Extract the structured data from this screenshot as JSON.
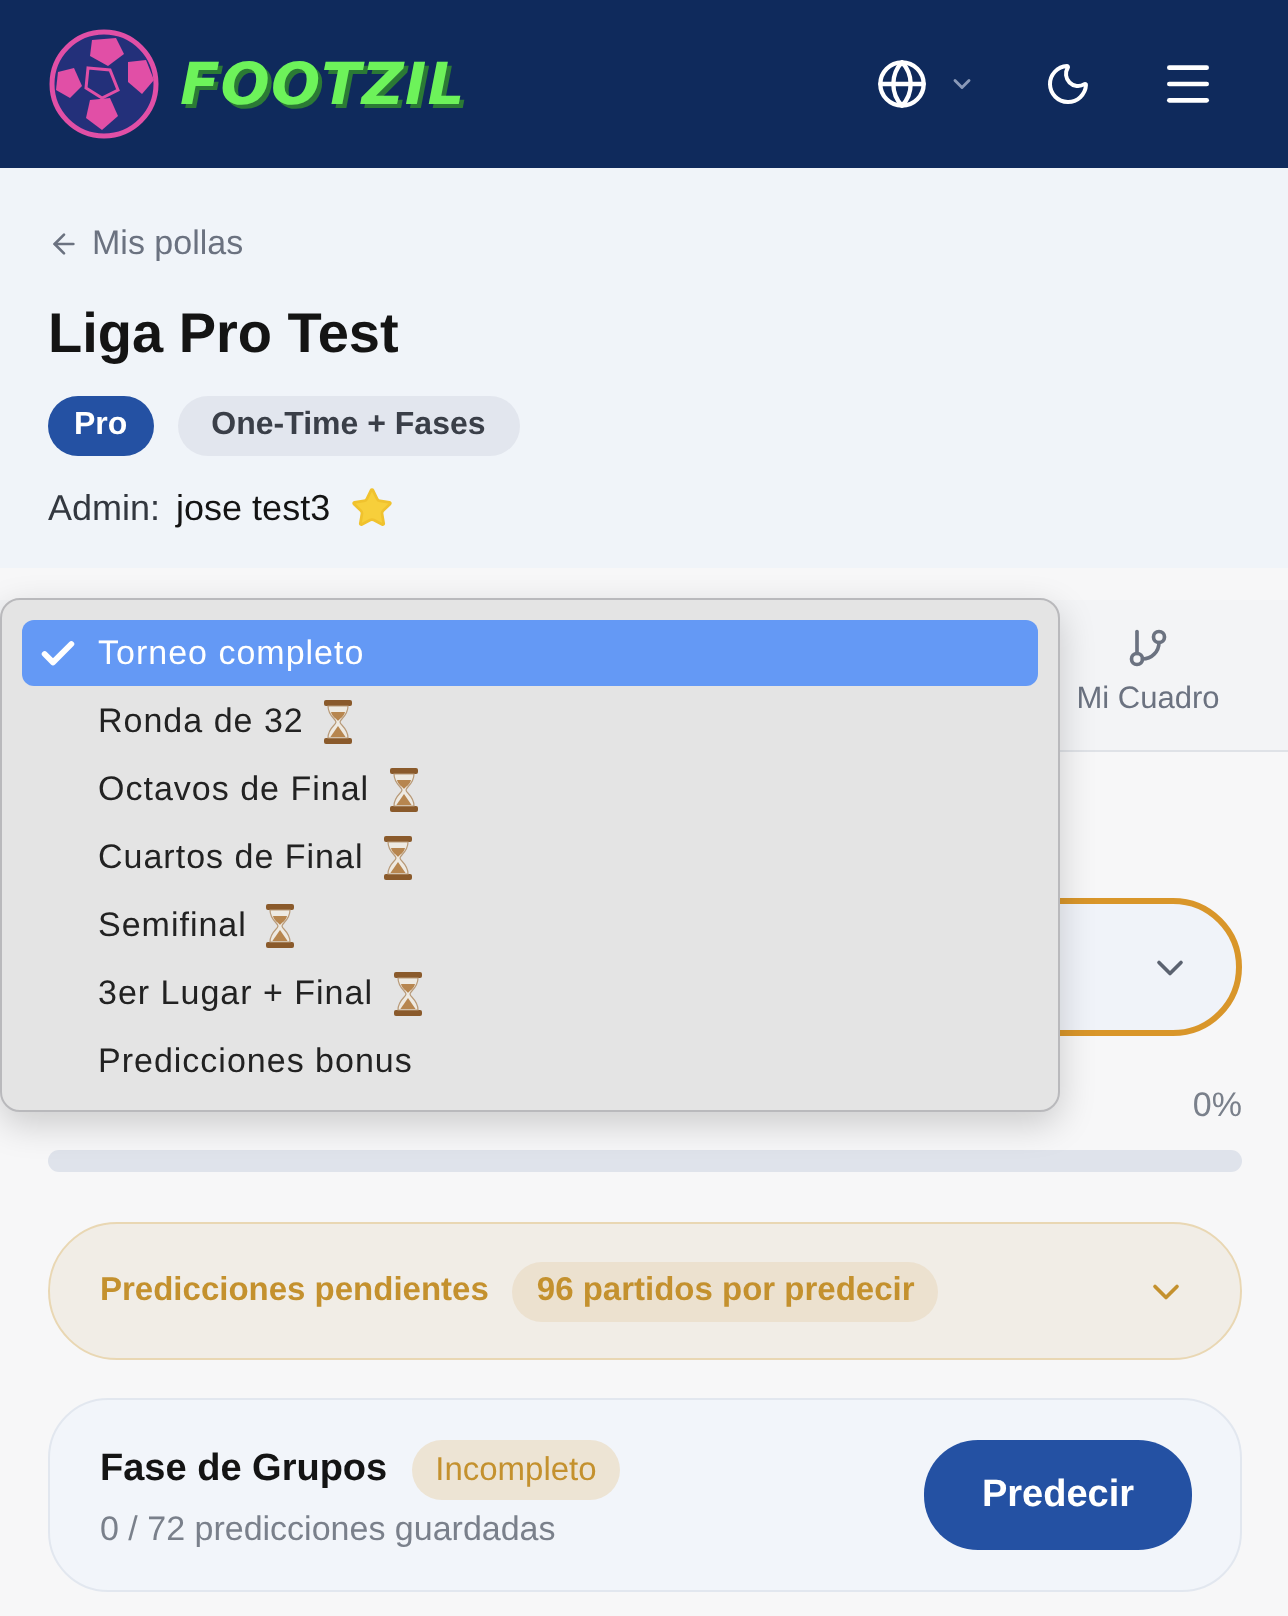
{
  "header": {
    "brand": "FOOTZIL"
  },
  "back_link": {
    "label": "Mis pollas"
  },
  "league": {
    "title": "Liga Pro Test",
    "badges": [
      {
        "label": "Pro",
        "kind": "plan"
      },
      {
        "label": "One-Time + Fases",
        "kind": "mode"
      }
    ],
    "admin_label": "Admin:",
    "admin_name": "jose test3"
  },
  "tabs": [
    {
      "label": "Mi Cuadro",
      "selected": false
    }
  ],
  "phase_select": {
    "expanded": true,
    "options": [
      {
        "label": "Torneo completo",
        "selected": true,
        "pending": false
      },
      {
        "label": "Ronda de 32",
        "selected": false,
        "pending": true
      },
      {
        "label": "Octavos de Final",
        "selected": false,
        "pending": true
      },
      {
        "label": "Cuartos de Final",
        "selected": false,
        "pending": true
      },
      {
        "label": "Semifinal",
        "selected": false,
        "pending": true
      },
      {
        "label": "3er Lugar + Final",
        "selected": false,
        "pending": true
      },
      {
        "label": "Predicciones bonus",
        "selected": false,
        "pending": false
      }
    ]
  },
  "progress": {
    "percent": "0%",
    "level": 0
  },
  "pending_panel": {
    "title": "Predicciones pendientes",
    "badge": "96 partidos por predecir",
    "expanded": false
  },
  "phases": [
    {
      "name": "Fase de Grupos",
      "status": "Incompleto",
      "complete": false,
      "progress_text": "0 / 72 predicciones guardadas",
      "button": "Predecir"
    }
  ]
}
